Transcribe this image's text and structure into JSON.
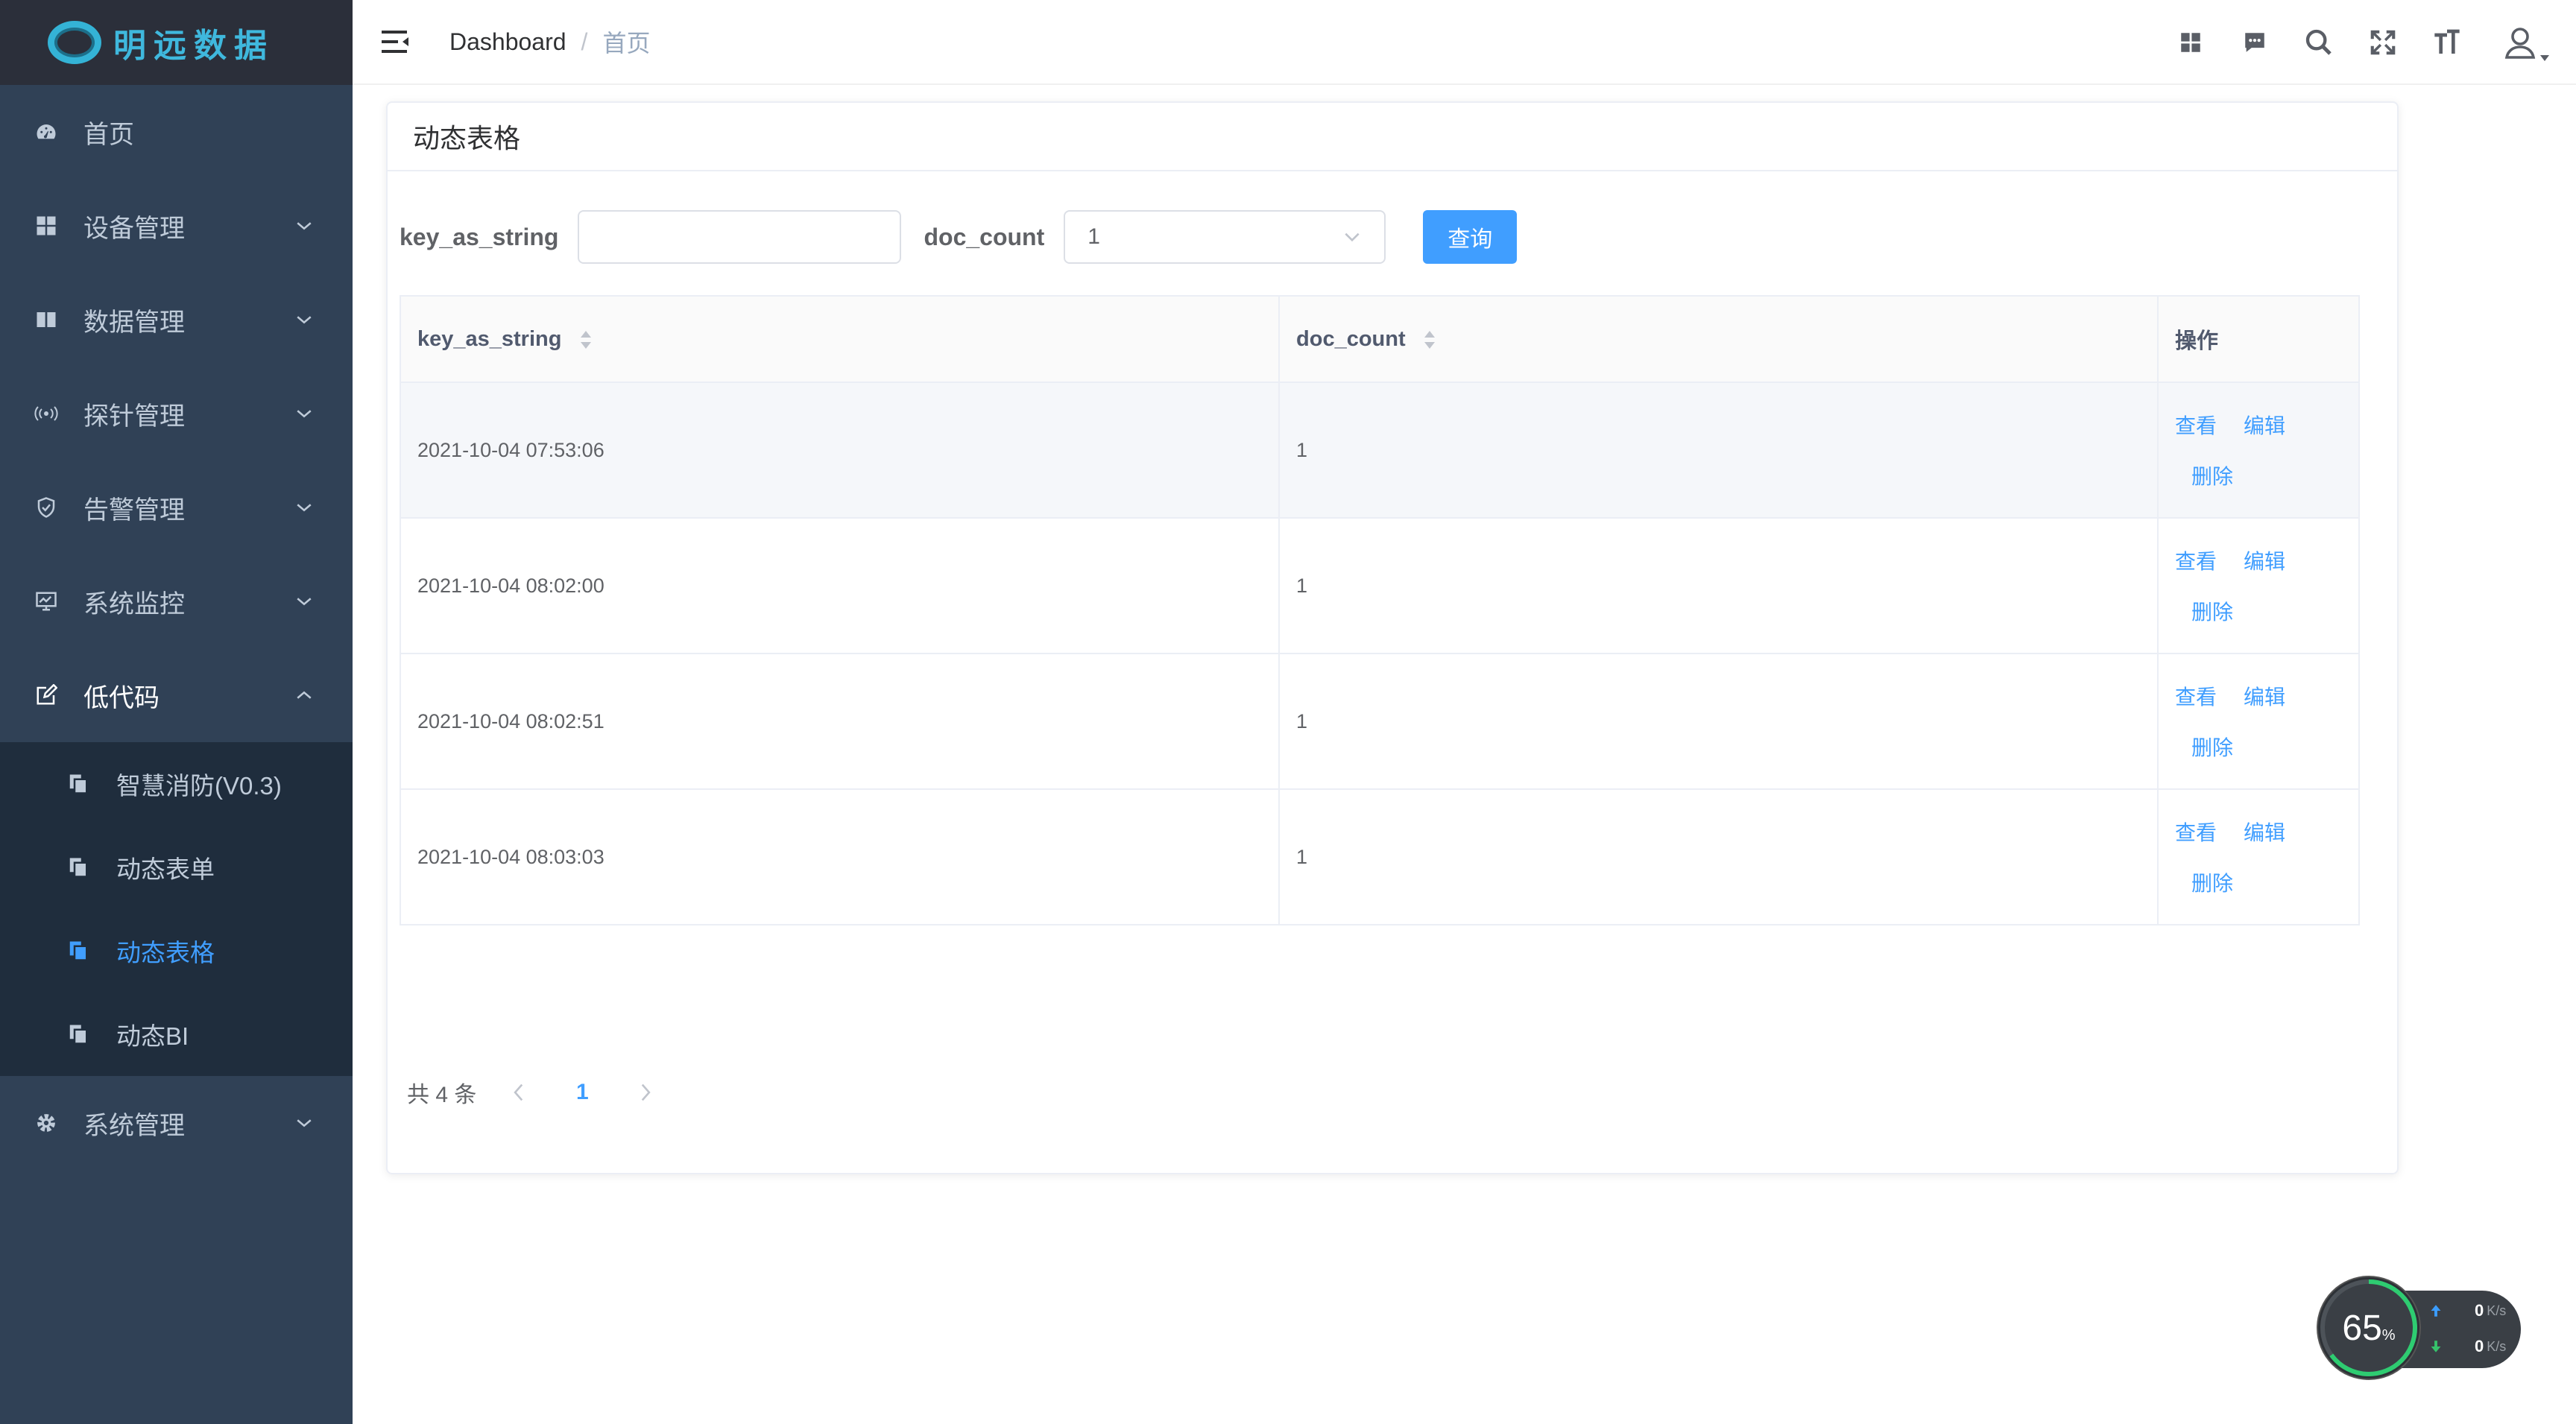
{
  "brand": {
    "name": "明远数据",
    "color": "#3fb8dd"
  },
  "sidebar": {
    "items": [
      {
        "label": "首页",
        "icon": "dashboard-icon",
        "has_children": false
      },
      {
        "label": "设备管理",
        "icon": "grid-icon",
        "has_children": true
      },
      {
        "label": "数据管理",
        "icon": "book-icon",
        "has_children": true
      },
      {
        "label": "探针管理",
        "icon": "signal-icon",
        "has_children": true
      },
      {
        "label": "告警管理",
        "icon": "shield-icon",
        "has_children": true
      },
      {
        "label": "系统监控",
        "icon": "monitor-icon",
        "has_children": true
      },
      {
        "label": "低代码",
        "icon": "edit-icon",
        "has_children": true,
        "open": true
      },
      {
        "label": "系统管理",
        "icon": "gear-icon",
        "has_children": true
      }
    ],
    "submenu": [
      {
        "label": "智慧消防(V0.3)",
        "active": false
      },
      {
        "label": "动态表单",
        "active": false
      },
      {
        "label": "动态表格",
        "active": true
      },
      {
        "label": "动态BI",
        "active": false
      }
    ]
  },
  "header": {
    "breadcrumb": [
      "Dashboard",
      "首页"
    ],
    "separator": "/"
  },
  "card": {
    "title": "动态表格",
    "filter": {
      "field1_label": "key_as_string",
      "field1_value": "",
      "field2_label": "doc_count",
      "field2_value": "1",
      "search_button": "查询"
    },
    "table": {
      "columns": [
        "key_as_string",
        "doc_count",
        "操作"
      ],
      "rows": [
        {
          "key_as_string": "2021-10-04 07:53:06",
          "doc_count": "1"
        },
        {
          "key_as_string": "2021-10-04 08:02:00",
          "doc_count": "1"
        },
        {
          "key_as_string": "2021-10-04 08:02:51",
          "doc_count": "1"
        },
        {
          "key_as_string": "2021-10-04 08:03:03",
          "doc_count": "1"
        }
      ],
      "actions": {
        "view": "查看",
        "edit": "编辑",
        "delete": "删除"
      }
    },
    "pagination": {
      "total_text": "共 4 条",
      "current_page": "1"
    }
  },
  "netspeed": {
    "percent": "65",
    "percent_unit": "%",
    "up": "0",
    "down": "0",
    "unit": "K/s"
  },
  "colors": {
    "sidebar_bg": "#304156",
    "submenu_bg": "#1f2d3d",
    "accent": "#409eff",
    "sidebar_text": "#bfcbd9"
  }
}
